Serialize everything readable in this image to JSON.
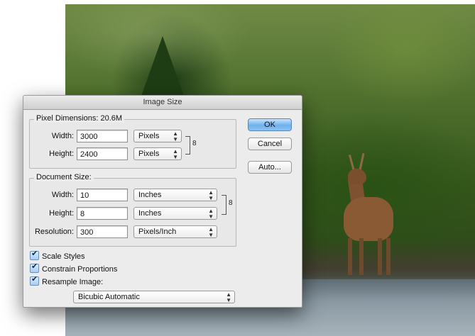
{
  "dialog": {
    "title": "Image Size",
    "pixel_dimensions": {
      "legend": "Pixel Dimensions:  20.6M",
      "width_label": "Width:",
      "width_value": "3000",
      "width_unit": "Pixels",
      "height_label": "Height:",
      "height_value": "2400",
      "height_unit": "Pixels"
    },
    "document_size": {
      "legend": "Document Size:",
      "width_label": "Width:",
      "width_value": "10",
      "width_unit": "Inches",
      "height_label": "Height:",
      "height_value": "8",
      "height_unit": "Inches",
      "resolution_label": "Resolution:",
      "resolution_value": "300",
      "resolution_unit": "Pixels/Inch"
    },
    "buttons": {
      "ok": "OK",
      "cancel": "Cancel",
      "auto": "Auto..."
    },
    "options": {
      "scale_styles": "Scale Styles",
      "constrain_proportions": "Constrain Proportions",
      "resample_image": "Resample Image:",
      "resample_method": "Bicubic Automatic"
    }
  },
  "icons": {
    "select_arrows": "⌃⌄",
    "link_chain": "8"
  }
}
